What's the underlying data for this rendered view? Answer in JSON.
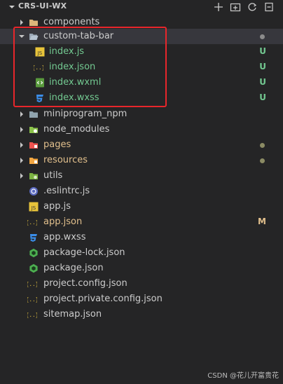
{
  "explorer": {
    "title": "CRS-UI-WX",
    "actions": [
      {
        "name": "new-file-icon"
      },
      {
        "name": "new-folder-icon"
      },
      {
        "name": "refresh-icon"
      },
      {
        "name": "collapse-all-icon"
      }
    ]
  },
  "tree": {
    "components": "components",
    "custom_tab_bar": "custom-tab-bar",
    "index_js": "index.js",
    "index_json": "index.json",
    "index_wxml": "index.wxml",
    "index_wxss": "index.wxss",
    "miniprogram_npm": "miniprogram_npm",
    "node_modules": "node_modules",
    "pages": "pages",
    "resources": "resources",
    "utils": "utils",
    "eslintrc": ".eslintrc.js",
    "app_js": "app.js",
    "app_json": "app.json",
    "app_wxss": "app.wxss",
    "package_lock": "package-lock.json",
    "package_json": "package.json",
    "project_config": "project.config.json",
    "project_private_config": "project.private.config.json",
    "sitemap": "sitemap.json"
  },
  "decorations": {
    "untracked": "U",
    "modified": "M"
  },
  "colors": {
    "untracked": "#73c991",
    "modified": "#e2c08d",
    "dot": "#8b8b8b",
    "highlight": "#e8262b"
  },
  "watermark": "CSDN @花儿开富贵花"
}
